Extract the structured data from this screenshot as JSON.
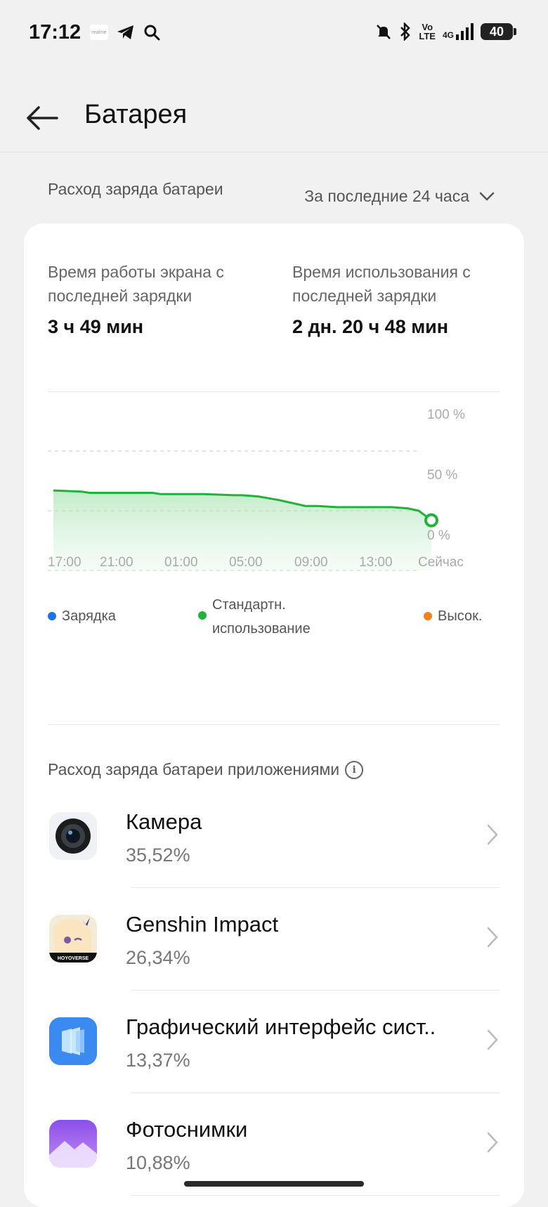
{
  "status_bar": {
    "time": "17:12",
    "battery_level": "40",
    "left_icons": [
      "realme-icon",
      "telegram-icon",
      "search-icon"
    ],
    "right_icons": [
      "mute-icon",
      "bluetooth-icon",
      "volte-icon",
      "signal-4g-icon",
      "battery-icon"
    ],
    "volte_top": "Vo",
    "volte_bottom": "LTE",
    "network": "4G"
  },
  "app_bar": {
    "title": "Батарея"
  },
  "summary": {
    "label": "Расход заряда батареи",
    "period": "За последние 24 часа"
  },
  "stats": {
    "screen_time_label": "Время работы экрана с последней зарядки",
    "screen_time_value": "3 ч 49 мин",
    "usage_time_label": "Время использования с последней зарядки",
    "usage_time_value": "2 дн. 20 ч 48 мин"
  },
  "chart_data": {
    "type": "area",
    "x_tick_labels": [
      "17:00",
      "21:00",
      "01:00",
      "05:00",
      "09:00",
      "13:00",
      "Сейчас"
    ],
    "y_tick_labels": [
      "100 %",
      "50 %",
      "0 %"
    ],
    "ylim": [
      0,
      100
    ],
    "series": [
      {
        "color": "#1fb33a",
        "x_hours": [
          0,
          1.8,
          2.3,
          4.5,
          6.3,
          6.8,
          9.5,
          11.5,
          12.0,
          13.0,
          14.3,
          16.0,
          16.8,
          18.0,
          21.5,
          22.5,
          23.2,
          24.0
        ],
        "values": [
          67,
          66,
          65,
          65,
          65,
          64,
          64,
          63,
          63,
          62,
          59,
          54,
          54,
          53,
          53,
          52,
          50,
          42
        ]
      }
    ],
    "grid": true
  },
  "legend": [
    {
      "label": "Зарядка",
      "color": "#1a73e8"
    },
    {
      "label": "Стандартн. использование",
      "color": "#1fb33a"
    },
    {
      "label": "Высок.",
      "color": "#f08020"
    }
  ],
  "apps_section": {
    "heading": "Расход заряда батареи приложениями",
    "apps": [
      {
        "name": "Камера",
        "percent": "35,52%",
        "icon": "camera-app-icon"
      },
      {
        "name": "Genshin Impact",
        "percent": "26,34%",
        "icon": "genshin-impact-app-icon",
        "icon_text": "HOYOVERSE"
      },
      {
        "name": "Графический интерфейс сист..",
        "percent": "13,37%",
        "icon": "system-ui-app-icon"
      },
      {
        "name": "Фотоснимки",
        "percent": "10,88%",
        "icon": "photos-app-icon"
      }
    ]
  }
}
